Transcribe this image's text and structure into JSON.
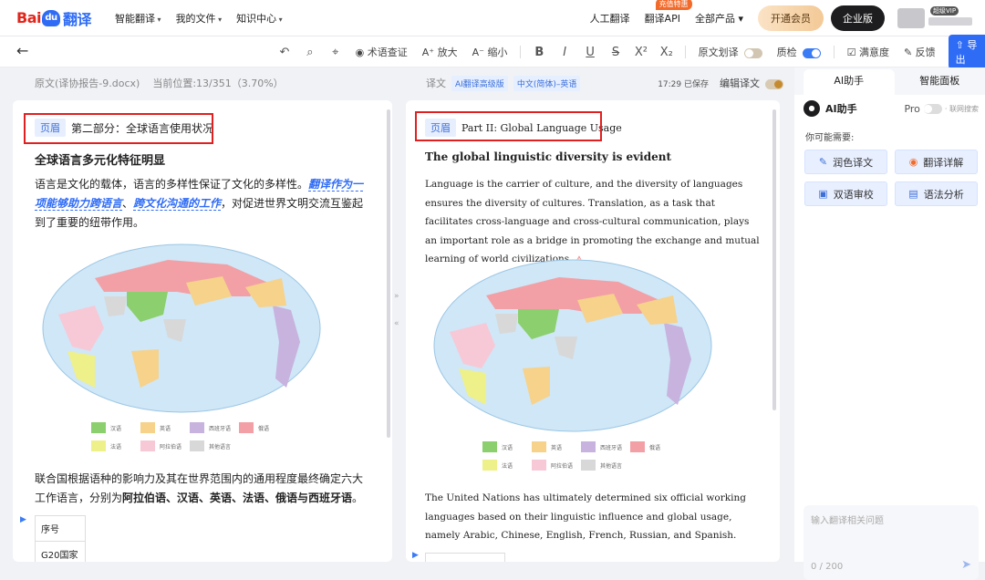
{
  "logo": {
    "bai": "Bai",
    "du": "du",
    "fanyi": "翻译"
  },
  "topnav": [
    "智能翻译",
    "我的文件",
    "知识中心"
  ],
  "topright": {
    "human": "人工翻译",
    "api": "翻译API",
    "promo": "充值特惠",
    "products": "全部产品",
    "vip": "开通会员",
    "enterprise": "企业版",
    "user_badge": "超级VIP"
  },
  "toolbar": {
    "term_check": "术语查证",
    "zoom_in": "放大",
    "zoom_out": "缩小",
    "bold": "B",
    "italic": "I",
    "underline": "U",
    "strike": "S",
    "sup": "X²",
    "sub": "X₂",
    "source_mode": "原文划译",
    "quality": "质检",
    "satisfaction": "满意度",
    "feedback": "反馈",
    "export": "导出"
  },
  "source": {
    "filename": "原文(译协报告-9.docx)",
    "position": "当前位置:13/351（3.70%）",
    "header_tag": "页眉",
    "header_text": "第二部分：全球语言使用状况",
    "title": "全球语言多元化特征明显",
    "p1_a": "语言是文化的载体，语言的多样性保证了文化的多样性。",
    "p1_em1": "翻译作为一项能够助力跨语言",
    "p1_sep": "、",
    "p1_em2": "跨文化沟通的工作",
    "p1_b": "，对促进世界文明交流互鉴起到了重要的纽带作用。",
    "p2_a": "联合国根据语种的影响力及其在世界范围内的通用程度最终确定六大工作语言，分别为",
    "p2_b": "阿拉伯语、汉语、英语、法语、俄语与西班牙语",
    "p2_c": "。",
    "table": [
      "序号",
      "G20国家"
    ]
  },
  "target": {
    "label": "译文",
    "tag1": "AI翻译高级版",
    "tag2": "中文(简体)–英语",
    "saved": "17:29 已保存",
    "edit": "编辑译文",
    "header_tag": "页眉",
    "header_text": "Part II: Global Language Usage",
    "title": "The global linguistic diversity is evident",
    "p1": "Language is the carrier of culture, and the diversity of languages ensures the diversity of cultures. Translation, as a task that facilitates cross-language and cross-cultural communication, plays an important role as a bridge in promoting the exchange and mutual learning of world civilizations.",
    "warn": "⚠",
    "p2": "The United Nations has ultimately determined six official working languages based on their linguistic influence and global usage, namely Arabic, Chinese, English, French, Russian, and Spanish."
  },
  "legend": [
    {
      "label": "汉语",
      "color": "#8ccf6e"
    },
    {
      "label": "英语",
      "color": "#f6d28b"
    },
    {
      "label": "西班牙语",
      "color": "#c7b3de"
    },
    {
      "label": "俄语",
      "color": "#f2a0a6"
    },
    {
      "label": "法语",
      "color": "#eef08a"
    },
    {
      "label": "阿拉伯语",
      "color": "#f7c9d7"
    },
    {
      "label": "其他语言",
      "color": "#d8d8d8"
    }
  ],
  "ai": {
    "tab1": "AI助手",
    "tab2": "智能面板",
    "title": "AI助手",
    "pro": "Pro",
    "search": "· 联网搜索",
    "need": "你可能需要:",
    "chips": [
      "润色译文",
      "翻译详解",
      "双语审校",
      "语法分析"
    ],
    "ask_placeholder": "输入翻译相关问题",
    "count": "0 / 200"
  }
}
